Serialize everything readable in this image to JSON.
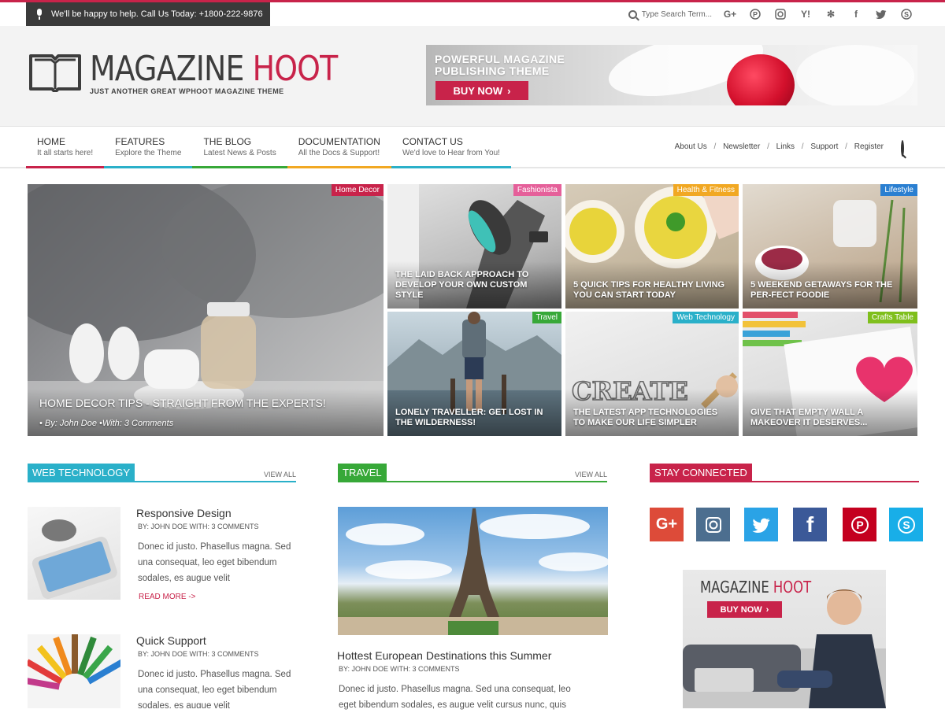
{
  "topbar": {
    "help_text": "We'll be happy to help. Call Us Today: +1800-222-9876",
    "search_placeholder": "Type Search Term...",
    "social_icons": [
      "google-plus-icon",
      "pinterest-icon",
      "instagram-icon",
      "yahoo-icon",
      "yelp-icon",
      "facebook-icon",
      "twitter-icon",
      "skype-icon"
    ]
  },
  "header": {
    "logo_word1": "MAGAZINE ",
    "logo_word2": "HOOT",
    "tagline": "JUST ANOTHER GREAT WPHOOT MAGAZINE THEME",
    "banner_line1": "POWERFUL MAGAZINE",
    "banner_line2": "PUBLISHING THEME",
    "banner_button": "BUY NOW"
  },
  "nav": {
    "items": [
      {
        "title": "HOME",
        "sub": "It all starts here!",
        "color": "#c8234a"
      },
      {
        "title": "FEATURES",
        "sub": "Explore the Theme",
        "color": "#2ab0c9"
      },
      {
        "title": "THE BLOG",
        "sub": "Latest News & Posts",
        "color": "#37a838"
      },
      {
        "title": "DOCUMENTATION",
        "sub": "All the Docs & Support!",
        "color": "#f1a823"
      },
      {
        "title": "CONTACT US",
        "sub": "We'd love to Hear from You!",
        "color": "#2ab0c9"
      }
    ],
    "secondary": [
      "About Us",
      "Newsletter",
      "Links",
      "Support",
      "Register"
    ]
  },
  "hero": {
    "big": {
      "tag": "Home Decor",
      "tag_color": "#c8234a",
      "title": "HOME DECOR TIPS - STRAIGHT FROM THE EXPERTS!",
      "meta": "• By: John Doe   •With: 3 Comments"
    },
    "tiles": [
      {
        "tag": "Fashionista",
        "tag_color": "#e5609a",
        "title": "THE LAID BACK APPROACH TO DEVELOP YOUR OWN CUSTOM STYLE"
      },
      {
        "tag": "Health & Fitness",
        "tag_color": "#f1a823",
        "title": "5 QUICK TIPS FOR HEALTHY LIVING YOU CAN START TODAY"
      },
      {
        "tag": "Lifestyle",
        "tag_color": "#2a7fd1",
        "title": "5 WEEKEND GETAWAYS FOR THE PER-FECT FOODIE"
      },
      {
        "tag": "Travel",
        "tag_color": "#37a838",
        "title": "LONELY TRAVELLER: GET LOST IN THE WILDERNESS!"
      },
      {
        "tag": "Web Technology",
        "tag_color": "#2ab0c9",
        "title": "THE LATEST APP TECHNOLOGIES TO MAKE OUR LIFE SIMPLER"
      },
      {
        "tag": "Crafts Table",
        "tag_color": "#7fbf1c",
        "title": "GIVE THAT EMPTY WALL A MAKEOVER IT DESERVES..."
      }
    ]
  },
  "web_tech": {
    "heading": "WEB TECHNOLOGY",
    "heading_color": "#2ab0c9",
    "view_all": "VIEW ALL",
    "posts": [
      {
        "title": "Responsive Design",
        "meta": "BY: JOHN DOE     WITH: 3 COMMENTS",
        "excerpt": "Donec id justo. Phasellus magna. Sed una consequat, leo eget bibendum sodales, es augue velit",
        "read_more": "READ MORE ->"
      },
      {
        "title": "Quick Support",
        "meta": "BY: JOHN DOE     WITH: 3 COMMENTS",
        "excerpt": "Donec id justo. Phasellus magna. Sed una consequat, leo eget bibendum sodales, es augue velit"
      }
    ]
  },
  "travel": {
    "heading": "TRAVEL",
    "heading_color": "#37a838",
    "view_all": "VIEW ALL",
    "post_title": "Hottest European Destinations this Summer",
    "post_meta": "BY: JOHN DOE     WITH: 3 COMMENTS",
    "excerpt_line1": "Donec id justo. Phasellus magna. Sed una consequat, leo",
    "excerpt_line2": "eget bibendum sodales, es augue velit cursus nunc, quis"
  },
  "stay_connected": {
    "heading": "STAY CONNECTED",
    "heading_color": "#c8234a",
    "icons": [
      {
        "name": "google-plus-icon",
        "glyph": "G+",
        "color": "#dd4b39"
      },
      {
        "name": "instagram-icon",
        "glyph": "◙",
        "color": "#4c6e8f"
      },
      {
        "name": "twitter-icon",
        "glyph": "🐦",
        "color": "#2aa3e6"
      },
      {
        "name": "facebook-icon",
        "glyph": "f",
        "color": "#3b5998"
      },
      {
        "name": "pinterest-icon",
        "glyph": "P",
        "color": "#c4001f"
      },
      {
        "name": "skype-icon",
        "glyph": "S",
        "color": "#18aee8"
      }
    ],
    "ad_word1": "MAGAZINE ",
    "ad_word2": "HOOT",
    "ad_button": "BUY NOW"
  }
}
